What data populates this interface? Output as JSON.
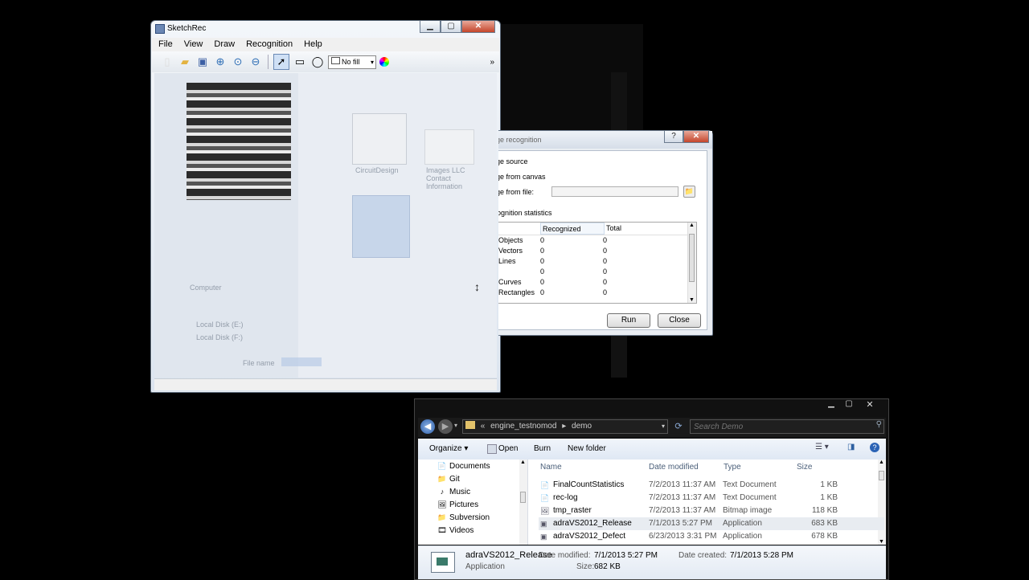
{
  "sketchrec": {
    "title": "SketchRec",
    "menu": [
      "File",
      "View",
      "Draw",
      "Recognition",
      "Help"
    ],
    "fill_select": "No fill",
    "bg_ghost_labels": [
      "CircuitDesign",
      "Images LLC Contact Information",
      "Computer",
      "Local Disk (E:)",
      "Local Disk (F:)",
      "File name"
    ]
  },
  "dialog": {
    "title": "Image recognition",
    "source_label": "Image source",
    "option_canvas": "Image from canvas",
    "option_file": "Image from file:",
    "file_value": "",
    "stats_label": "Recognition statistics",
    "columns": [
      "",
      "Recognized",
      "Total"
    ],
    "rows": [
      {
        "name": "Objects",
        "recognized": "0",
        "total": "0"
      },
      {
        "name": "Vectors",
        "recognized": "0",
        "total": "0"
      },
      {
        "name": "Lines",
        "recognized": "0",
        "total": "0"
      },
      {
        "name": "",
        "recognized": "0",
        "total": "0"
      },
      {
        "name": "Curves",
        "recognized": "0",
        "total": "0"
      },
      {
        "name": "Rectangles",
        "recognized": "0",
        "total": "0"
      }
    ],
    "run_label": "Run",
    "close_label": "Close"
  },
  "explorer": {
    "breadcrumb": [
      "«",
      "engine_testnomod",
      "▸",
      "demo"
    ],
    "search_placeholder": "Search Demo",
    "toolbar": {
      "organize": "Organize ▾",
      "open": "Open",
      "burn": "Burn",
      "new_folder": "New folder"
    },
    "nav_items": [
      {
        "icon": "📄",
        "label": "Documents"
      },
      {
        "icon": "📁",
        "label": "Git"
      },
      {
        "icon": "♪",
        "label": "Music"
      },
      {
        "icon": "🖼",
        "label": "Pictures"
      },
      {
        "icon": "📁",
        "label": "Subversion"
      },
      {
        "icon": "🎞",
        "label": "Videos"
      }
    ],
    "columns": {
      "name": "Name",
      "date": "Date modified",
      "type": "Type",
      "size": "Size"
    },
    "files": [
      {
        "name": "FinalCountStatistics",
        "date": "7/2/2013 11:37 AM",
        "type": "Text Document",
        "size": "1 KB",
        "icon": "📄"
      },
      {
        "name": "rec-log",
        "date": "7/2/2013 11:37 AM",
        "type": "Text Document",
        "size": "1 KB",
        "icon": "📄"
      },
      {
        "name": "tmp_raster",
        "date": "7/2/2013 11:37 AM",
        "type": "Bitmap image",
        "size": "118 KB",
        "icon": "🖼"
      },
      {
        "name": "adraVS2012_Release",
        "date": "7/1/2013 5:27 PM",
        "type": "Application",
        "size": "683 KB",
        "icon": "▣"
      },
      {
        "name": "adraVS2012_Defect",
        "date": "6/23/2013 3:31 PM",
        "type": "Application",
        "size": "678 KB",
        "icon": "▣"
      }
    ],
    "details": {
      "name": "adraVS2012_Release",
      "kind": "Application",
      "modified_label": "Date modified:",
      "modified": "7/1/2013 5:27 PM",
      "created_label": "Date created:",
      "created": "7/1/2013 5:28 PM",
      "size_label": "Size:",
      "size": "682 KB"
    }
  }
}
